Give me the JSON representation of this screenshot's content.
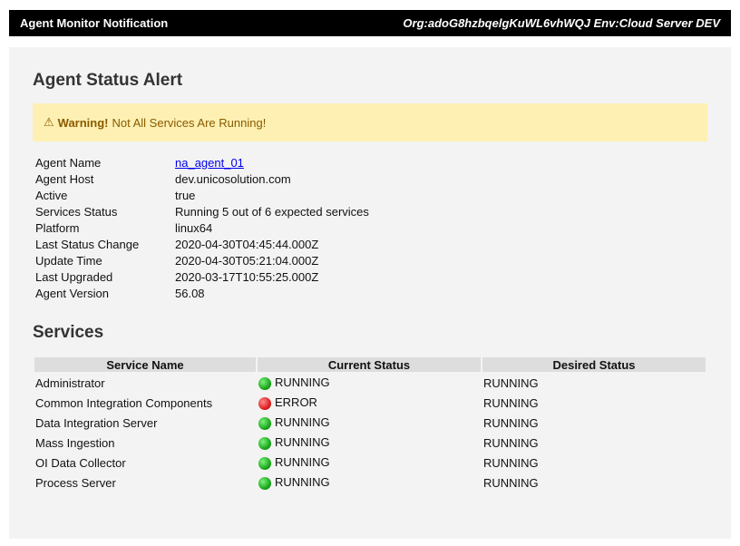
{
  "header": {
    "title": "Agent Monitor Notification",
    "org_env": "Org:adoG8hzbqelgKuWL6vhWQJ Env:Cloud Server DEV"
  },
  "alert": {
    "title": "Agent Status Alert",
    "warning_icon": "⚠",
    "warning_strong": "Warning!",
    "warning_text": "Not All Services Are Running!"
  },
  "details": [
    {
      "label": "Agent Name",
      "value": "na_agent_01",
      "link": true
    },
    {
      "label": "Agent Host",
      "value": "dev.unicosolution.com"
    },
    {
      "label": "Active",
      "value": "true"
    },
    {
      "label": "Services Status",
      "value": "Running 5 out of 6 expected services"
    },
    {
      "label": "Platform",
      "value": "linux64"
    },
    {
      "label": "Last Status Change",
      "value": "2020-04-30T04:45:44.000Z"
    },
    {
      "label": "Update Time",
      "value": "2020-04-30T05:21:04.000Z"
    },
    {
      "label": "Last Upgraded",
      "value": "2020-03-17T10:55:25.000Z"
    },
    {
      "label": "Agent Version",
      "value": "56.08"
    }
  ],
  "services": {
    "title": "Services",
    "columns": [
      "Service Name",
      "Current Status",
      "Desired Status"
    ],
    "rows": [
      {
        "name": "Administrator",
        "current": "RUNNING",
        "current_state": "ok",
        "desired": "RUNNING"
      },
      {
        "name": "Common Integration Components",
        "current": "ERROR",
        "current_state": "error",
        "desired": "RUNNING"
      },
      {
        "name": "Data Integration Server",
        "current": "RUNNING",
        "current_state": "ok",
        "desired": "RUNNING"
      },
      {
        "name": "Mass Ingestion",
        "current": "RUNNING",
        "current_state": "ok",
        "desired": "RUNNING"
      },
      {
        "name": "OI Data Collector",
        "current": "RUNNING",
        "current_state": "ok",
        "desired": "RUNNING"
      },
      {
        "name": "Process Server",
        "current": "RUNNING",
        "current_state": "ok",
        "desired": "RUNNING"
      }
    ]
  },
  "colors": {
    "header_bg": "#000000",
    "warning_bg": "#fdf0b2",
    "warning_text": "#8a5a00",
    "running": "#14a314",
    "error": "#dc1a1a",
    "link": "#0000ee"
  }
}
